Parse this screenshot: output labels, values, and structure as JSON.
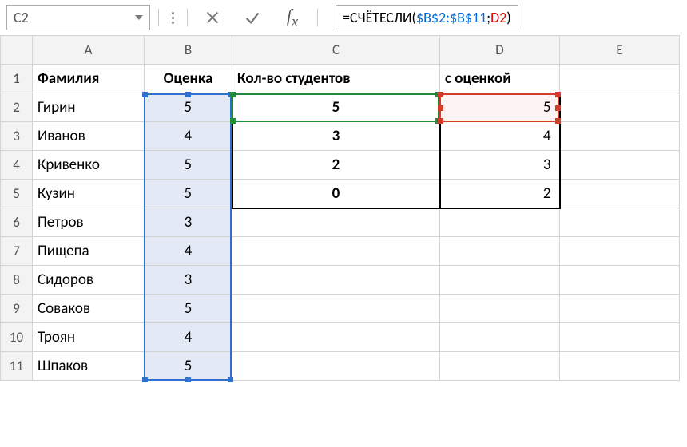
{
  "namebox": "C2",
  "formula": {
    "prefix": "=СЧЁТЕСЛИ(",
    "arg1": "$B$2:$B$11",
    "sep": ";",
    "arg2": "D2",
    "suffix": ")"
  },
  "columns": [
    "A",
    "B",
    "C",
    "D",
    "E"
  ],
  "rowNumbers": [
    "1",
    "2",
    "3",
    "4",
    "5",
    "6",
    "7",
    "8",
    "9",
    "10",
    "11"
  ],
  "header": {
    "A": "Фамилия",
    "B": "Оценка",
    "C": "Кол-во студентов",
    "D": "с оценкой"
  },
  "rows": [
    {
      "A": "Гирин",
      "B": "5",
      "C": "5",
      "D": "5"
    },
    {
      "A": "Иванов",
      "B": "4",
      "C": "3",
      "D": "4"
    },
    {
      "A": "Кривенко",
      "B": "5",
      "C": "2",
      "D": "3"
    },
    {
      "A": "Кузин",
      "B": "5",
      "C": "0",
      "D": "2"
    },
    {
      "A": "Петров",
      "B": "3"
    },
    {
      "A": "Пищепа",
      "B": "4"
    },
    {
      "A": "Сидоров",
      "B": "3"
    },
    {
      "A": "Соваков",
      "B": "5"
    },
    {
      "A": "Троян",
      "B": "4"
    },
    {
      "A": "Шпаков",
      "B": "5"
    }
  ]
}
